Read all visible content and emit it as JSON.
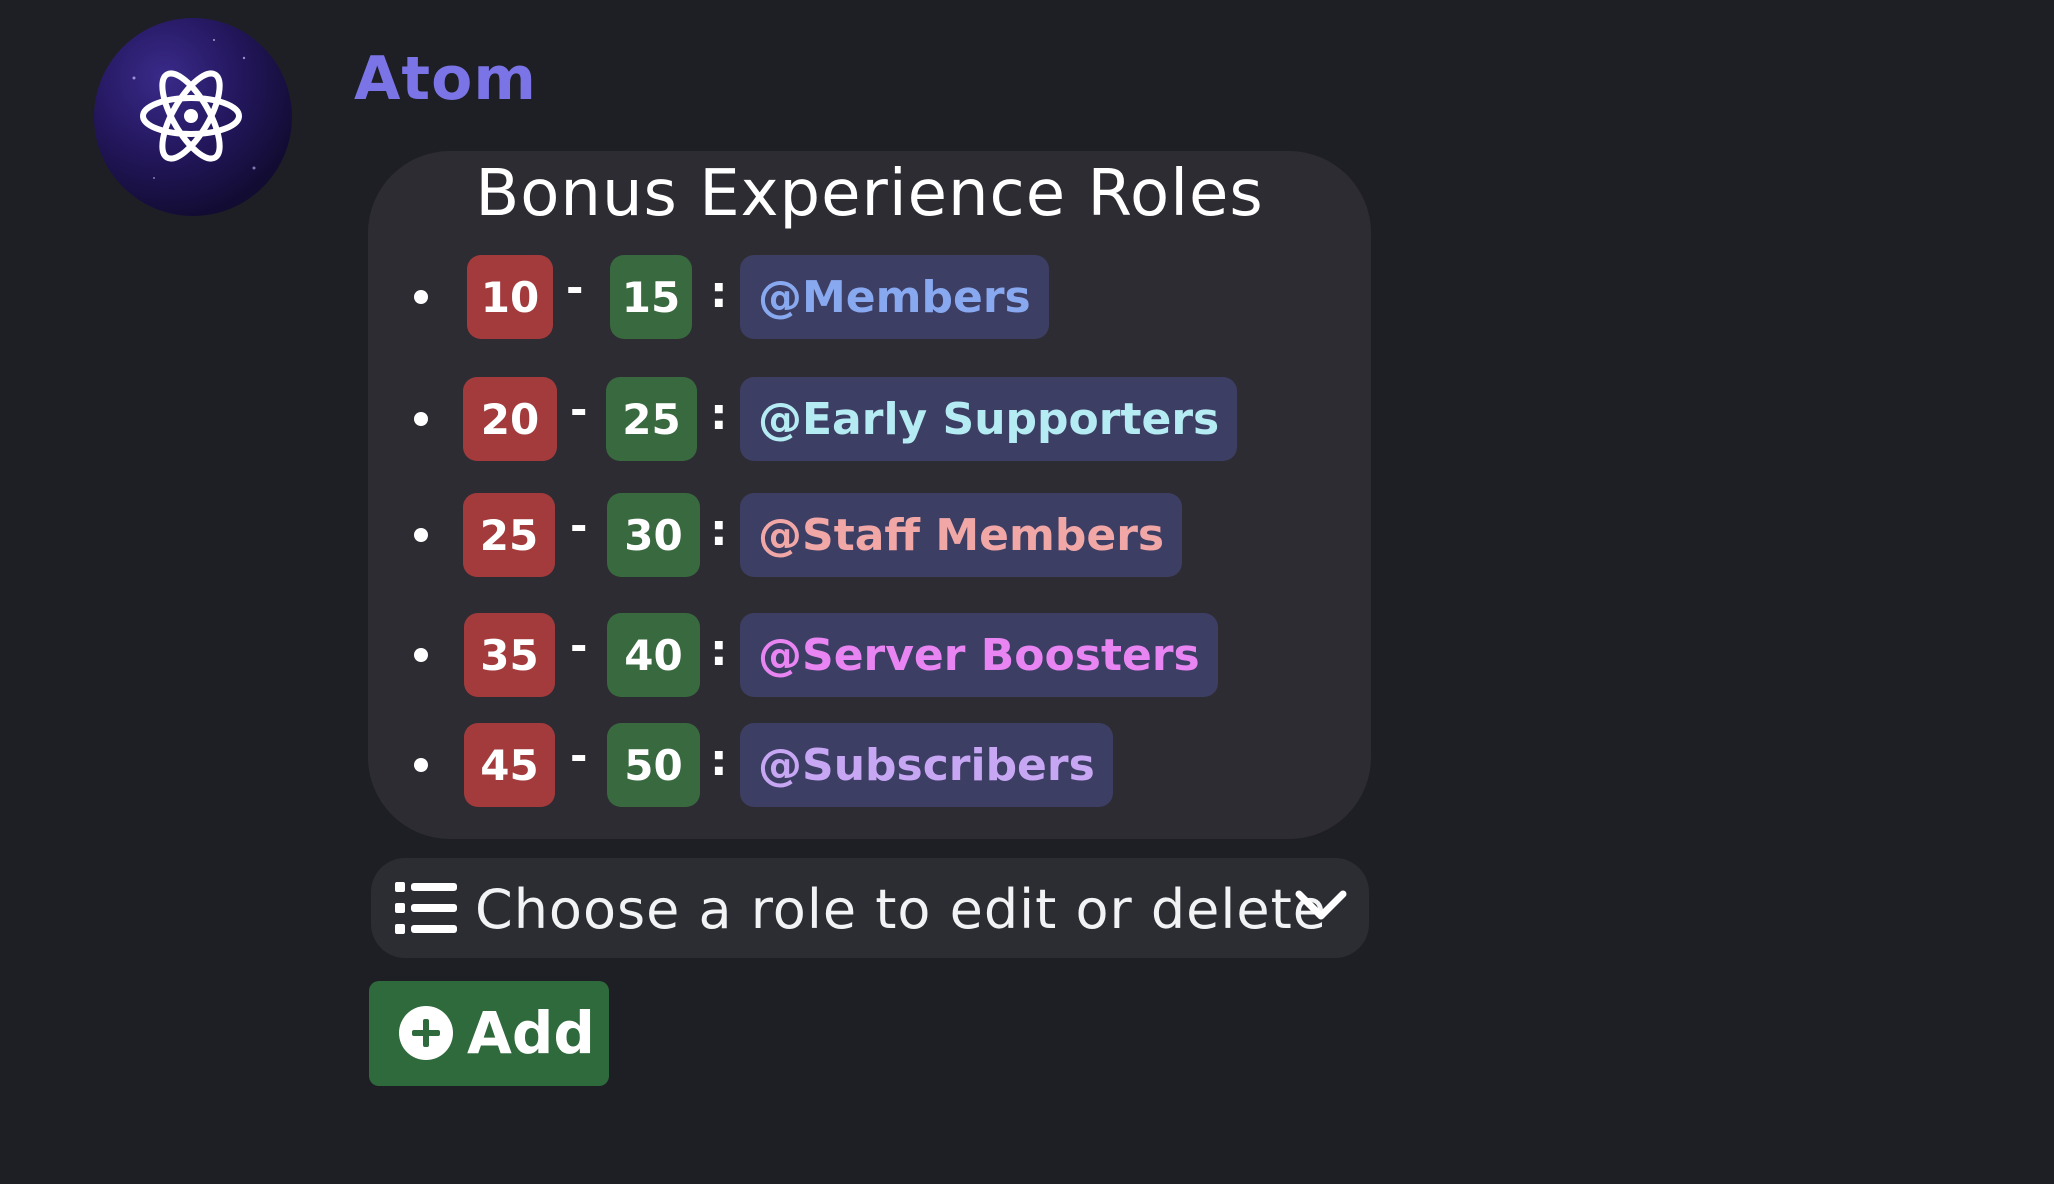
{
  "bot": {
    "name": "Atom",
    "name_color": "#7b74e6",
    "avatar_icon": "atom-icon"
  },
  "embed": {
    "title": "Bonus Experience Roles",
    "rows": [
      {
        "min": "10",
        "max": "15",
        "role": "@Members",
        "role_color": "#88a9f0"
      },
      {
        "min": "20",
        "max": "25",
        "role": "@Early Supporters",
        "role_color": "#b5ecf3"
      },
      {
        "min": "25",
        "max": "30",
        "role": "@Staff Members",
        "role_color": "#f2a7a7"
      },
      {
        "min": "35",
        "max": "40",
        "role": "@Server Boosters",
        "role_color": "#e985f2"
      },
      {
        "min": "45",
        "max": "50",
        "role": "@Subscribers",
        "role_color": "#c7a6f3"
      }
    ],
    "separator_dash": "-",
    "separator_colon": ":"
  },
  "select": {
    "placeholder": "Choose a role to edit or delete",
    "icon": "list-icon",
    "chevron": "chevron-down-icon"
  },
  "add_button": {
    "label": "Add",
    "icon": "plus-circle-icon"
  },
  "colors": {
    "min_badge": "#a33b3d",
    "max_badge": "#38693f",
    "role_pill": "#3d3e63",
    "add_button": "#2f6a3c"
  }
}
